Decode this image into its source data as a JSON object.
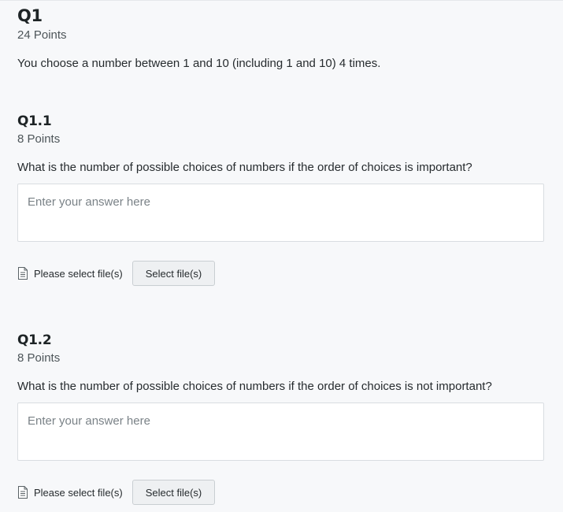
{
  "q1": {
    "title": "Q1",
    "points": "24 Points",
    "prompt": "You choose a number between 1 and 10 (including 1 and 10) 4 times."
  },
  "q1_1": {
    "title": "Q1.1",
    "points": "8 Points",
    "prompt": "What is the number of possible choices of numbers if the order of choices is important?",
    "answer": {
      "value": "",
      "placeholder": "Enter your answer here"
    },
    "file": {
      "icon": "document-icon",
      "label": "Please select file(s)",
      "button_label": "Select file(s)"
    }
  },
  "q1_2": {
    "title": "Q1.2",
    "points": "8 Points",
    "prompt": "What is the number of possible choices of numbers if the order of choices is not important?",
    "answer": {
      "value": "",
      "placeholder": "Enter your answer here"
    },
    "file": {
      "icon": "document-icon",
      "label": "Please select file(s)",
      "button_label": "Select file(s)"
    }
  }
}
